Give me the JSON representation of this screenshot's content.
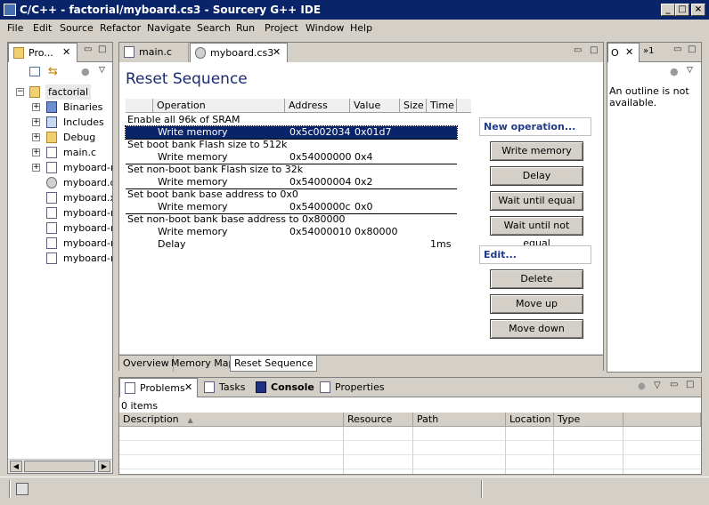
{
  "window": {
    "title": "C/C++ - factorial/myboard.cs3 - Sourcery G++ IDE"
  },
  "menu": [
    "File",
    "Edit",
    "Source",
    "Refactor",
    "Navigate",
    "Search",
    "Run",
    "Project",
    "Window",
    "Help"
  ],
  "project_view": {
    "tab_label": "Pro...",
    "root": "factorial",
    "items": [
      "Binaries",
      "Includes",
      "Debug",
      "main.c",
      "myboard-re",
      "myboard.cs",
      "myboard.x",
      "myboard-ra",
      "myboard-ra",
      "myboard-ro",
      "myboard-ro"
    ]
  },
  "editor": {
    "tabs": [
      "main.c",
      "myboard.cs3"
    ],
    "title": "Reset Sequence",
    "columns": [
      "Operation",
      "Address",
      "Value",
      "Size",
      "Time"
    ],
    "rows": [
      {
        "desc": "Enable all 96k of SRAM",
        "op": "",
        "addr": "",
        "val": "",
        "time": ""
      },
      {
        "desc": "",
        "op": "Write memory",
        "addr": "0x5c002034",
        "val": "0x01d7",
        "time": ""
      },
      {
        "desc": "Set boot bank Flash size to 512k",
        "op": "",
        "addr": "",
        "val": "",
        "time": ""
      },
      {
        "desc": "",
        "op": "Write memory",
        "addr": "0x54000000",
        "val": "0x4",
        "time": ""
      },
      {
        "desc": "Set non-boot bank Flash size to 32k",
        "op": "",
        "addr": "",
        "val": "",
        "time": ""
      },
      {
        "desc": "",
        "op": "Write memory",
        "addr": "0x54000004",
        "val": "0x2",
        "time": ""
      },
      {
        "desc": "Set boot bank base address to 0x0",
        "op": "",
        "addr": "",
        "val": "",
        "time": ""
      },
      {
        "desc": "",
        "op": "Write memory",
        "addr": "0x5400000c",
        "val": "0x0",
        "time": ""
      },
      {
        "desc": "Set non-boot bank base address to 0x80000",
        "op": "",
        "addr": "",
        "val": "",
        "time": ""
      },
      {
        "desc": "",
        "op": "Write memory",
        "addr": "0x54000010",
        "val": "0x80000",
        "time": ""
      },
      {
        "desc": "",
        "op": "Delay",
        "addr": "",
        "val": "",
        "time": "1ms"
      }
    ],
    "new_op_header": "New operation...",
    "new_op_buttons": [
      "Write memory",
      "Delay",
      "Wait until equal",
      "Wait until not equal"
    ],
    "edit_header": "Edit...",
    "edit_buttons": [
      "Delete",
      "Move up",
      "Move down"
    ],
    "bottom_tabs": [
      "Overview",
      "Memory Map",
      "Reset Sequence"
    ]
  },
  "outline": {
    "tab_label": "O",
    "tab2_label": "»1",
    "message": "An outline is not available."
  },
  "problems": {
    "tabs": [
      "Problems",
      "Tasks",
      "Console",
      "Properties"
    ],
    "count": "0 items",
    "columns": [
      "Description",
      "Resource",
      "Path",
      "Location",
      "Type"
    ]
  },
  "icons": [
    "app-icon",
    "folder-icon",
    "file-icon",
    "close-icon",
    "minimize-icon",
    "maximize-icon",
    "collapse-icon",
    "link-icon",
    "menu-icon"
  ]
}
